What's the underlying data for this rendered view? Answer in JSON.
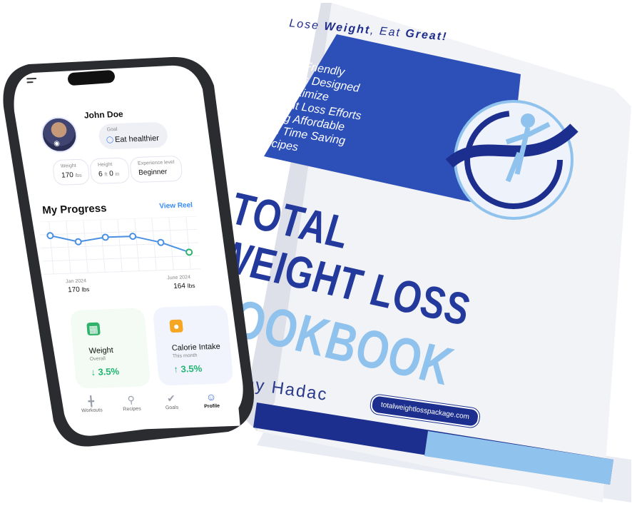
{
  "book": {
    "tagline_pre": "Lose ",
    "tagline_b1": "Weight",
    "tagline_mid": ", Eat ",
    "tagline_b2": "Great!",
    "blurb_lines": [
      "Macro Friendly",
      "Recipes Designed",
      "To Maximize",
      "Weight Loss Efforts",
      "Using Affordable",
      "And Time Saving",
      "Recipes"
    ],
    "title_line1": "TOTAL",
    "title_line2": "WEIGHT LOSS",
    "title_line3": "COOKBOOK",
    "author": "ny Hadac",
    "website": "totalweightlosspackage.com",
    "colors": {
      "navy": "#233a9c",
      "light_blue": "#8fc2ec",
      "blurb_bg": "#2d4fb8"
    }
  },
  "phone": {
    "profile": {
      "name": "John Doe",
      "goal_label": "Goal",
      "goal_value": "Eat healthier",
      "weight_label": "Weight",
      "weight_value": "170",
      "weight_unit": "lbs",
      "height_label": "Height",
      "height_ft": "6",
      "height_ft_unit": "ft",
      "height_in": "0",
      "height_in_unit": "in",
      "experience_label": "Experience level",
      "experience_value": "Beginner"
    },
    "progress": {
      "title": "My Progress",
      "link": "View Reel",
      "start_label": "Jan 2024",
      "start_value": "170",
      "start_unit": "lbs",
      "end_label": "June 2024",
      "end_value": "164",
      "end_unit": "lbs"
    },
    "chart_data": {
      "type": "line",
      "x": [
        "Jan 2024",
        "",
        "",
        "",
        "",
        "June 2024"
      ],
      "values": [
        170,
        168,
        169,
        169,
        167,
        164
      ],
      "title": "",
      "xlabel": "",
      "ylabel": "",
      "grid": true
    },
    "metrics": [
      {
        "title": "Weight",
        "sub": "Overall",
        "value": "↓ 3.5%",
        "icon": "scale-icon"
      },
      {
        "title": "Calorie Intake",
        "sub": "This month",
        "value": "↑ 3.5%",
        "icon": "food-icon"
      }
    ],
    "nav": [
      {
        "label": "Workouts",
        "icon": "dumbbell-icon"
      },
      {
        "label": "Recipes",
        "icon": "spatula-icon"
      },
      {
        "label": "Goals",
        "icon": "check-circle-icon"
      },
      {
        "label": "Profile",
        "icon": "person-icon",
        "active": true
      }
    ]
  }
}
